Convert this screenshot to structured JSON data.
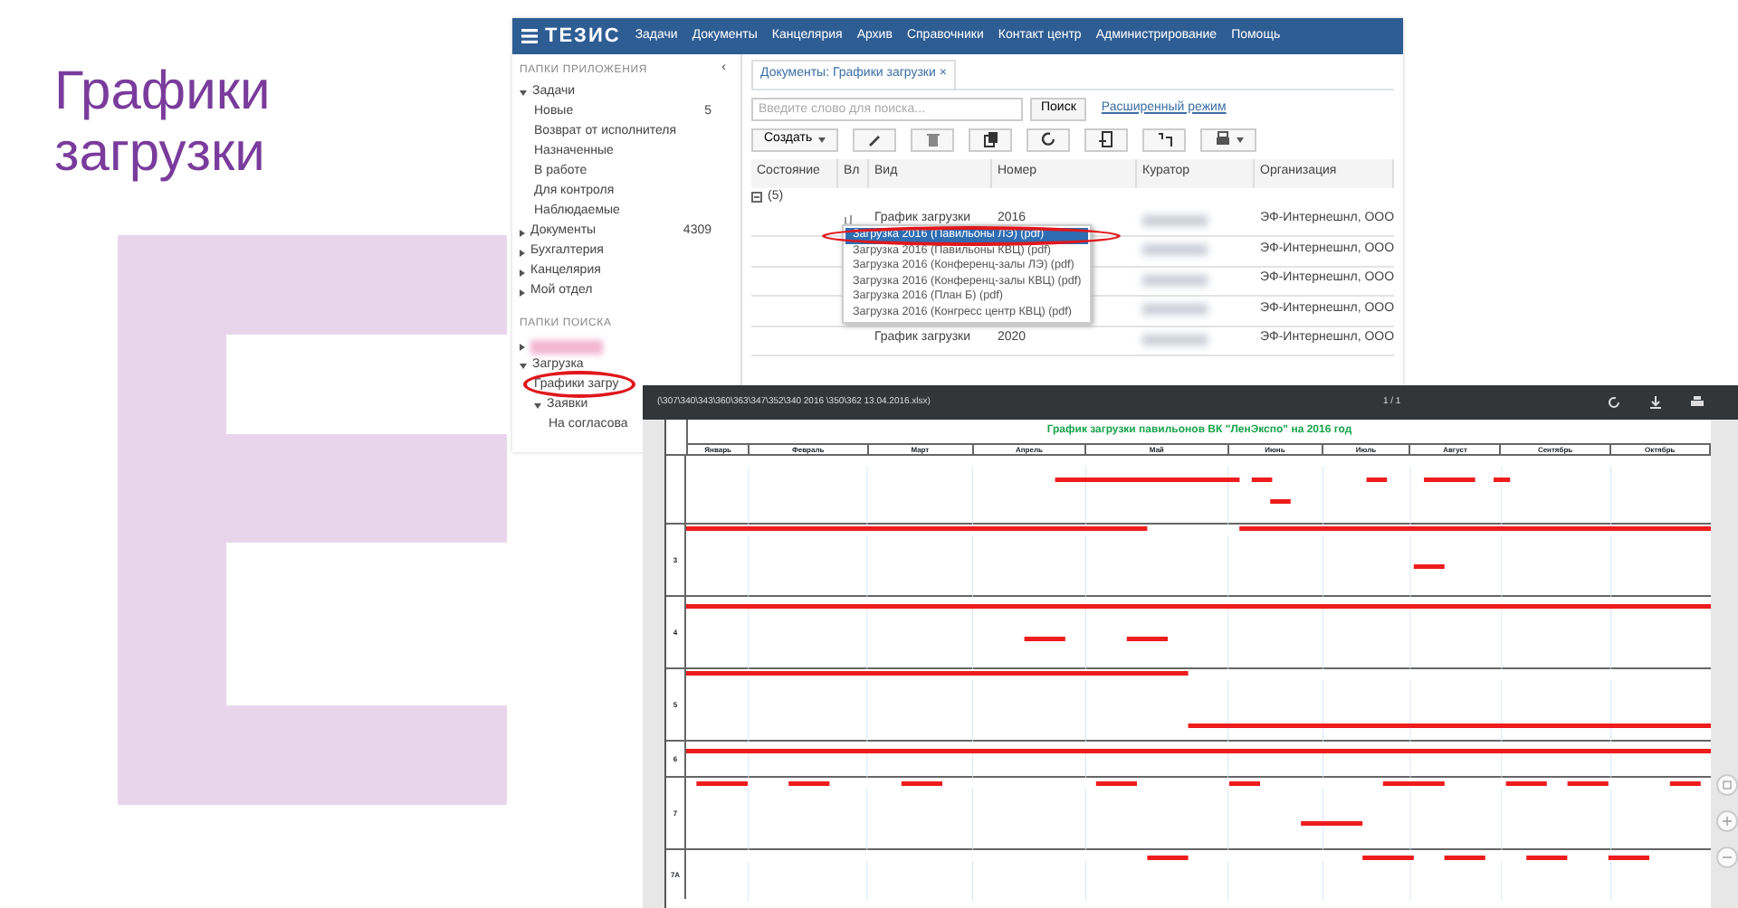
{
  "slide_title": "Графики загрузки",
  "app_window": {
    "logo": "ТЕЗИС",
    "menu": [
      "Задачи",
      "Документы",
      "Канцелярия",
      "Архив",
      "Справочники",
      "Контакт центр",
      "Администрирование",
      "Помощь"
    ],
    "sidebar": {
      "header": "ПАПКИ ПРИЛОЖЕНИЯ",
      "collapse": "‹",
      "tree": [
        {
          "kind": "folder",
          "label": "Задачи",
          "expanded": true,
          "children": [
            {
              "kind": "folder",
              "label": "Новые",
              "count": "5"
            },
            {
              "kind": "folder",
              "label": "Возврат от исполнителя"
            },
            {
              "kind": "folder",
              "label": "Назначенные"
            },
            {
              "kind": "folder",
              "label": "В работе"
            },
            {
              "kind": "folder",
              "label": "Для контроля"
            },
            {
              "kind": "folder",
              "label": "Наблюдаемые"
            }
          ]
        },
        {
          "kind": "folder",
          "label": "Документы",
          "expanded": false,
          "count": "4309"
        },
        {
          "kind": "folder",
          "label": "Бухгалтерия",
          "expanded": false
        },
        {
          "kind": "folder",
          "label": "Канцелярия",
          "expanded": false
        },
        {
          "kind": "folder",
          "label": "Мой отдел",
          "expanded": false
        }
      ],
      "search_header": "ПАПКИ ПОИСКА",
      "search_tree": [
        {
          "kind": "redacted",
          "expanded": false
        },
        {
          "kind": "folder",
          "label": "Загрузка",
          "expanded": true,
          "children": [
            {
              "kind": "folder",
              "label": "Графики загру",
              "circled": true
            },
            {
              "kind": "folder",
              "label": "Заявки",
              "expanded": true,
              "children": [
                {
                  "kind": "folder",
                  "label": "На согласова"
                }
              ]
            }
          ]
        }
      ]
    },
    "tab": {
      "label": "Документы: Графики загрузки",
      "close": "×"
    },
    "search": {
      "placeholder": "Введите слово для поиска...",
      "button": "Поиск",
      "advanced": "Расширенный режим"
    },
    "toolbar": {
      "create": "Создать"
    },
    "table": {
      "columns": [
        "Состояние",
        "Вл",
        "Вид",
        "Номер",
        "Куратор",
        "Организация"
      ],
      "group": "(5)",
      "rows": [
        {
          "vid": "График загрузки",
          "number": "2016",
          "org": "ЭФ-Интернешнл, ООО",
          "attachment": true
        },
        {
          "org": "ЭФ-Интернешнл, ООО"
        },
        {
          "org": "ЭФ-Интернешнл, ООО"
        },
        {
          "org": "ЭФ-Интернешнл, ООО"
        },
        {
          "vid": "График загрузки",
          "number": "2020",
          "org": "ЭФ-Интернешнл, ООО"
        }
      ]
    },
    "attachments_menu": [
      {
        "label": "Загрузка 2016 (Павильоны ЛЭ) (pdf)",
        "selected": true,
        "circled": true
      },
      {
        "label": "Загрузка 2016 (Павильоны КВЦ) (pdf)",
        "selected": false
      },
      {
        "label": "Загрузка 2016 (Конференц-залы ЛЭ) (pdf)",
        "selected": false
      },
      {
        "label": "Загрузка 2016 (Конференц-залы КВЦ) (pdf)",
        "selected": false
      },
      {
        "label": "Загрузка 2016 (План Б) (pdf)",
        "selected": false
      },
      {
        "label": "Загрузка 2016 (Конгресс центр КВЦ) (pdf)",
        "selected": false
      }
    ]
  },
  "viewer": {
    "filename": "(\\307\\340\\343\\360\\363\\347\\352\\340 2016 \\350\\362 13.04.2016.xlsx)",
    "page": "1 / 1",
    "chart_title": "График загрузки павильонов ВК \"ЛенЭкспо\" на 2016 год",
    "months": [
      "Январь",
      "Февраль",
      "Март",
      "Апрель",
      "Май",
      "Июнь",
      "Июль",
      "Август",
      "Сентябрь",
      "Октябрь"
    ],
    "rows": [
      {
        "kind": "tall"
      },
      {
        "label": "3"
      },
      {
        "label": "4"
      },
      {
        "label": "5"
      },
      {
        "label": "6",
        "kind": "short"
      },
      {
        "label": "7"
      },
      {
        "label": "7А",
        "kind": "cut"
      }
    ]
  }
}
